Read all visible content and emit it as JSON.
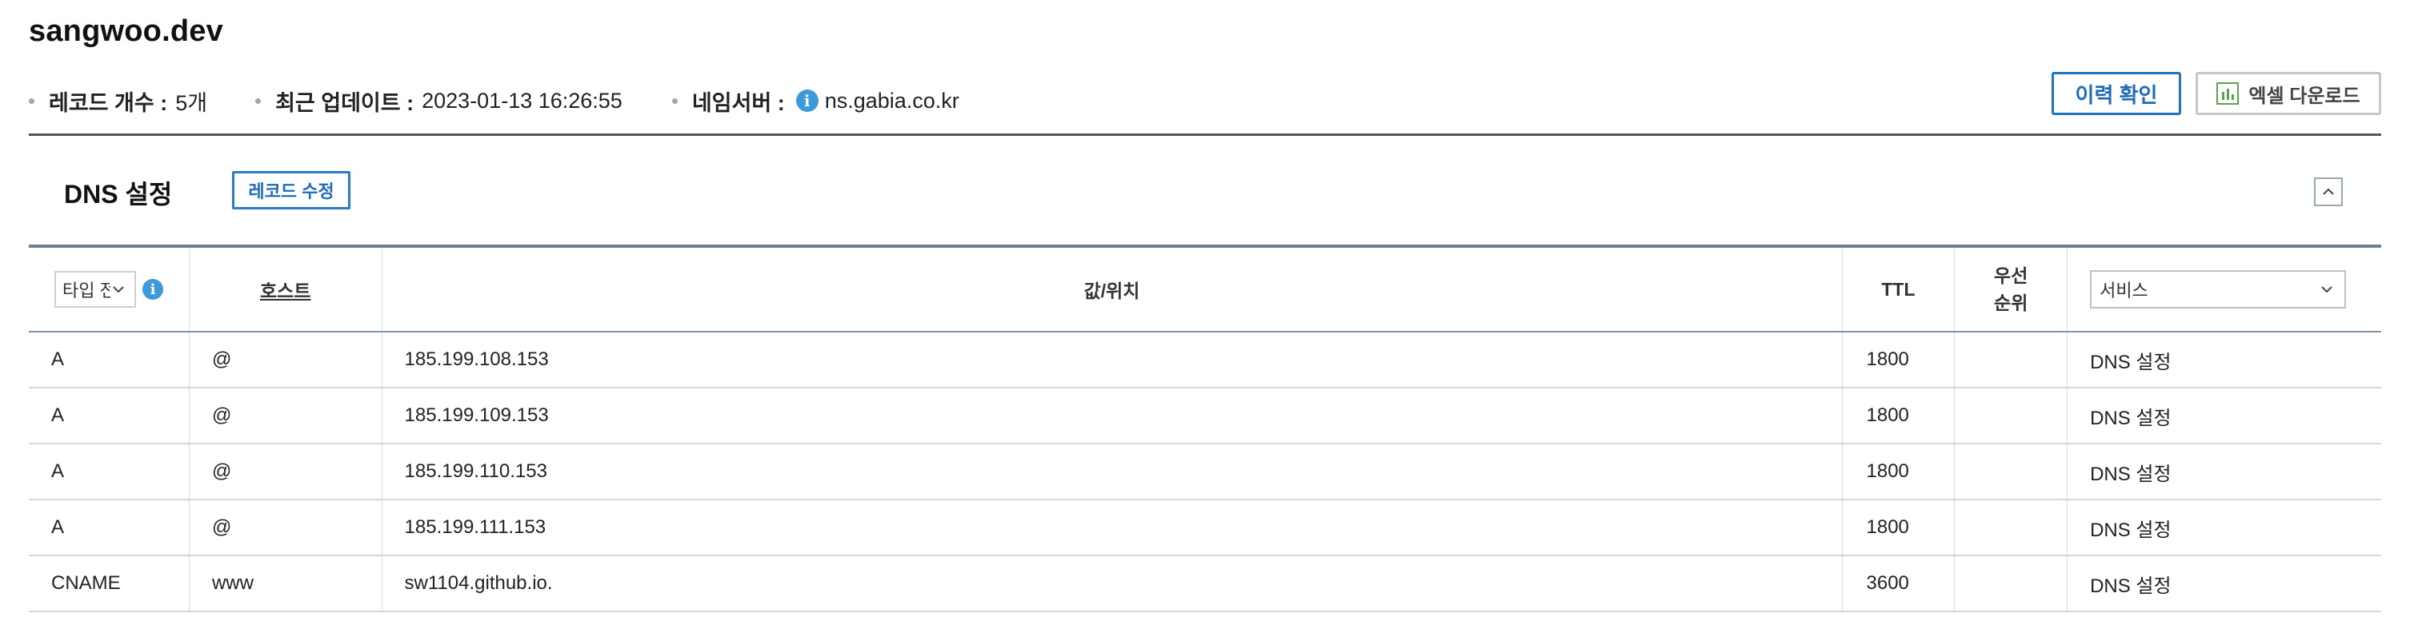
{
  "domain": "sangwoo.dev",
  "meta": {
    "record_count_label": "레코드 개수 :",
    "record_count_value": "5개",
    "last_update_label": "최근 업데이트 :",
    "last_update_value": "2023-01-13 16:26:55",
    "nameserver_label": "네임서버 :",
    "nameserver_value": "ns.gabia.co.kr"
  },
  "actions": {
    "history": "이력 확인",
    "excel": "엑셀 다운로드"
  },
  "section": {
    "title": "DNS 설정",
    "edit_button": "레코드 수정"
  },
  "table": {
    "type_filter_value": "타입 전체",
    "headers": {
      "host": "호스트",
      "value": "값/위치",
      "ttl": "TTL",
      "priority_line1": "우선",
      "priority_line2": "순위",
      "service_select": "서비스"
    },
    "rows": [
      {
        "type": "A",
        "host": "@",
        "value": "185.199.108.153",
        "ttl": "1800",
        "priority": "",
        "service": "DNS 설정"
      },
      {
        "type": "A",
        "host": "@",
        "value": "185.199.109.153",
        "ttl": "1800",
        "priority": "",
        "service": "DNS 설정"
      },
      {
        "type": "A",
        "host": "@",
        "value": "185.199.110.153",
        "ttl": "1800",
        "priority": "",
        "service": "DNS 설정"
      },
      {
        "type": "A",
        "host": "@",
        "value": "185.199.111.153",
        "ttl": "1800",
        "priority": "",
        "service": "DNS 설정"
      },
      {
        "type": "CNAME",
        "host": "www",
        "value": "sw1104.github.io.",
        "ttl": "3600",
        "priority": "",
        "service": "DNS 설정"
      }
    ]
  },
  "icons": {
    "info": "info-icon",
    "excel": "spreadsheet-chart-icon",
    "collapse": "chevron-up-icon",
    "dropdown": "chevron-down-icon"
  },
  "colors": {
    "accent_blue": "#1f74c0",
    "info_blue": "#3d9ad8",
    "excel_green": "#59a24f",
    "rule_dark": "#555555"
  }
}
